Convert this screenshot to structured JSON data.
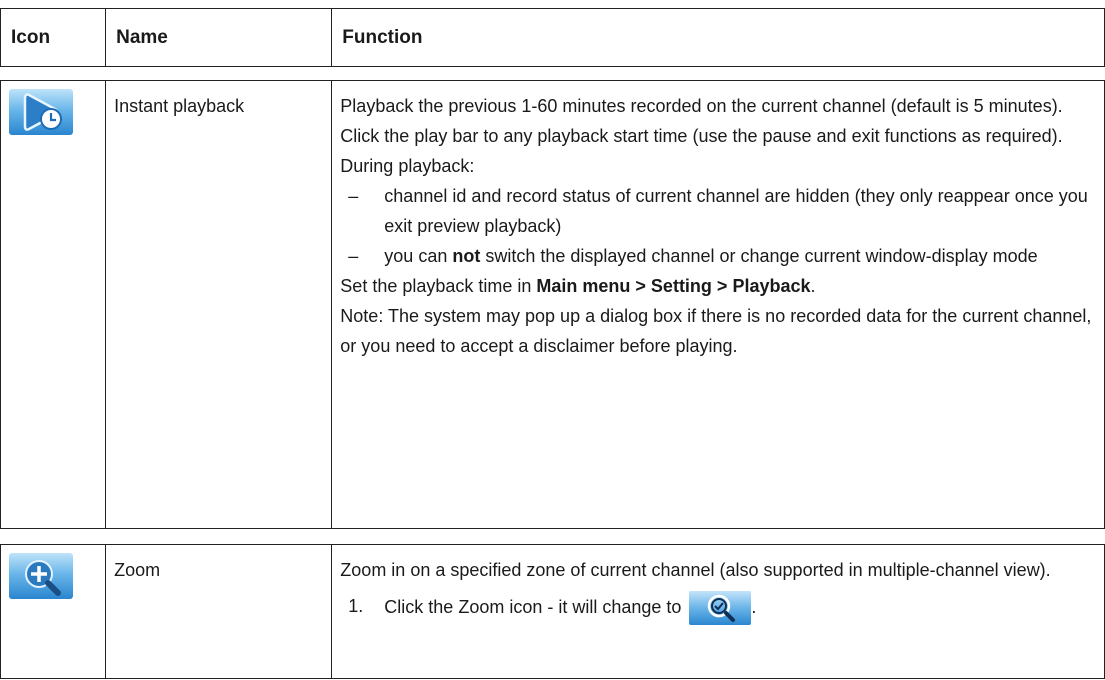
{
  "header": {
    "icon": "Icon",
    "name": "Name",
    "function": "Function"
  },
  "rows": [
    {
      "icon": "instant-playback-icon",
      "name": "Instant playback",
      "intro": "Playback the previous 1-60 minutes recorded on the current channel (default is 5 minutes). Click the play bar to any playback start time (use the pause and exit functions as required). During playback:",
      "bullets": [
        {
          "dash": "–",
          "text": "channel id and record status of current channel are hidden (they only reappear once you exit preview playback)"
        },
        {
          "dash": "–",
          "pre": "you can ",
          "bold": "not",
          "post": " switch the displayed channel or change current window-display mode"
        }
      ],
      "setting_pre": "Set the playback time in ",
      "setting_bold": "Main menu > Setting > Playback",
      "setting_post": ".",
      "note": "Note: The system may pop up a dialog box if there is no recorded data for the current channel, or you need to accept a disclaimer before playing."
    },
    {
      "icon": "zoom-in-icon",
      "name": "Zoom",
      "intro": "Zoom in on a specified zone of current channel (also supported in multiple-channel view).",
      "steps": [
        {
          "num": "1.",
          "text": "Click the Zoom icon - it will change to",
          "end": ".",
          "icon": "zoom-active-icon"
        }
      ]
    }
  ]
}
